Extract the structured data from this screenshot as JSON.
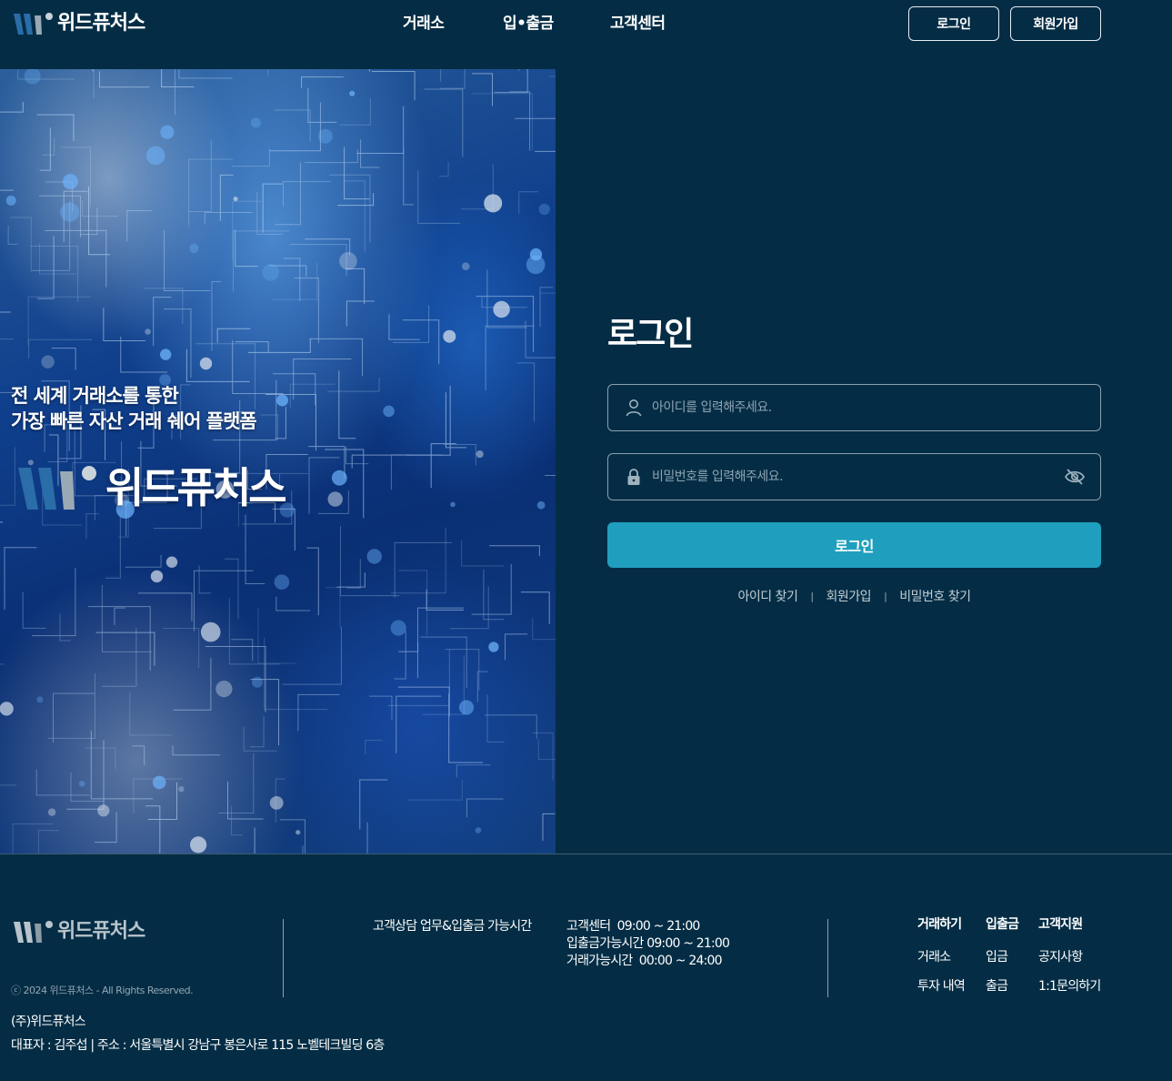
{
  "brand": {
    "name": "위드퓨처스",
    "colors": {
      "background": "#042d45",
      "accent": "#1f9fbd",
      "logo_blue": "#2a6da8",
      "logo_grey": "#9aa9b6"
    }
  },
  "header": {
    "nav": [
      "거래소",
      "입•출금",
      "고객센터"
    ],
    "login_label": "로그인",
    "signup_label": "회원가입"
  },
  "hero": {
    "line1": "전 세계 거래소를 통한",
    "line2": "가장 빠른 자산 거래 쉐어 플랫폼",
    "brand": "위드퓨처스"
  },
  "login": {
    "title": "로그인",
    "id_placeholder": "아이디를 입력해주세요.",
    "pw_placeholder": "비밀번호를 입력해주세요.",
    "submit_label": "로그인",
    "links": [
      "아이디 찾기",
      "회원가입",
      "비밀번호 찾기"
    ],
    "icons": {
      "id": "user-icon",
      "pw": "lock-icon",
      "toggle": "eye-off-icon"
    }
  },
  "footer": {
    "brand": "위드퓨처스",
    "copyright": "ⓒ 2024 위드퓨처스 - All Rights Reserved.",
    "hours_label": "고객상담 업무&입출금 가능시간",
    "hours": [
      "고객센터  09:00 ~ 21:00",
      "입출금가능시간 09:00 ~ 21:00",
      "거래가능시간  00:00 ~ 24:00"
    ],
    "columns": [
      {
        "heading": "거래하기",
        "items": [
          "거래소",
          "투자 내역"
        ]
      },
      {
        "heading": "입출금",
        "items": [
          "입금",
          "출금"
        ]
      },
      {
        "heading": "고객지원",
        "items": [
          "공지사항",
          "1:1문의하기"
        ]
      }
    ],
    "company": "(주)위드퓨처스",
    "address": "대표자 : 김주섭 | 주소 : 서울특별시 강남구 봉은사로 115 노벨테크빌딩 6층"
  }
}
